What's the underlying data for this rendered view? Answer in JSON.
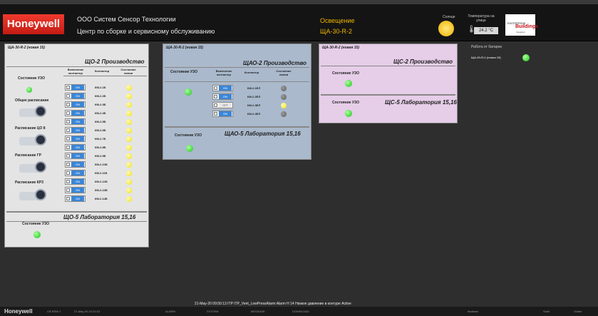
{
  "header": {
    "logo": "Honeywell",
    "company": "ООО Систем Сенсор Технологии",
    "center": "Центр по сборке и сервисному обслуживанию",
    "system": "Освещение",
    "cabinet": "ЩА-30-R-2",
    "sun_label": "Солнце",
    "temp_label": "Температура на улице",
    "temp_value": "24.2 °C",
    "ebi_logo": {
      "line1": "ENTERPRISE",
      "line2": "Buildings",
      "line3": "Integrator"
    }
  },
  "panel1": {
    "tag": "ЩА-30-R-2 (новая 15)",
    "title": "ЩО-2 Производство",
    "uzo_label": "Состояние УЗО",
    "col_headers": [
      "Включение контактор",
      "Контактор",
      "Состояние линии"
    ],
    "sched_labels": [
      "Общее расписание",
      "Расписание ЦО 8",
      "Расписание ГР",
      "Расписание КР3"
    ],
    "rows": [
      "КМ-2.1Б",
      "КМ-2.2Б",
      "КМ-2.3Б",
      "КМ-2.4Б",
      "КМ-2.5Б",
      "КМ-2.6Б",
      "КМ-2.7Б",
      "КМ-2.8Б",
      "КМ-2.9Б",
      "КМ-2.10Б",
      "КМ-2.11Б",
      "КМ-2.12Б",
      "КМ-2.13Б",
      "КМ-2.14Б"
    ],
    "switch_label": "ON",
    "sub_title": "ЩО-5 Лаборатория 15,16",
    "sub_uzo_label": "Состояние УЗО"
  },
  "panel2": {
    "tag": "ЩА-30-R-2 (новая 15)",
    "title": "ЩАО-2 Производство",
    "uzo_label": "Состояние УЗО",
    "col_headers": [
      "Включение контактор",
      "Контактор",
      "Состояние линии"
    ],
    "rows": [
      {
        "km": "КМ-2.1ЕЛ",
        "switch": "ON",
        "state": "off"
      },
      {
        "km": "КМ-2.2ЕЛ",
        "switch": "ON",
        "state": "off"
      },
      {
        "km": "КМ-2.3ЕЛ",
        "switch": "OFF",
        "state": "on"
      },
      {
        "km": "КМ-2.4ЕЛ",
        "switch": "ON",
        "state": "off"
      }
    ],
    "sub_title": "ЩАО-5 Лаборатория 15,16",
    "sub_uzo_label": "Состояние УЗО"
  },
  "panel3": {
    "tag": "ЩА-30-R-2 (новая 15)",
    "title": "ЩС-2 Производство",
    "uzo_label": "Состояние УЗО",
    "sub_title": "ЩС-5 Лаборатория 15,16",
    "sub_uzo_label": "Состояние УЗО"
  },
  "battery": {
    "title": "Работа от батареи",
    "item": "ЩА-30-R-2 (новая 15)"
  },
  "alarm": {
    "text": "21-May-20  09:50:13  ITP   ITP_Vent_LowPressAlarm  Alarm   H 14 Низкое давление в контуре   Active"
  },
  "footer": {
    "logo": "Honeywell",
    "station": "CB RSW 1",
    "datetime": "21-May-20  10:21:43",
    "alarm": "ALARM",
    "system": "SYSTEM",
    "message": "MESSAGE",
    "download": "DOWNLOAD",
    "right1": "Iteations",
    "right2": "Shell",
    "right3": "Viuber"
  },
  "colors": {
    "accent": "#f0b400",
    "brand": "#d4231a",
    "ok": "#18c21a",
    "warn": "#f0e200"
  }
}
